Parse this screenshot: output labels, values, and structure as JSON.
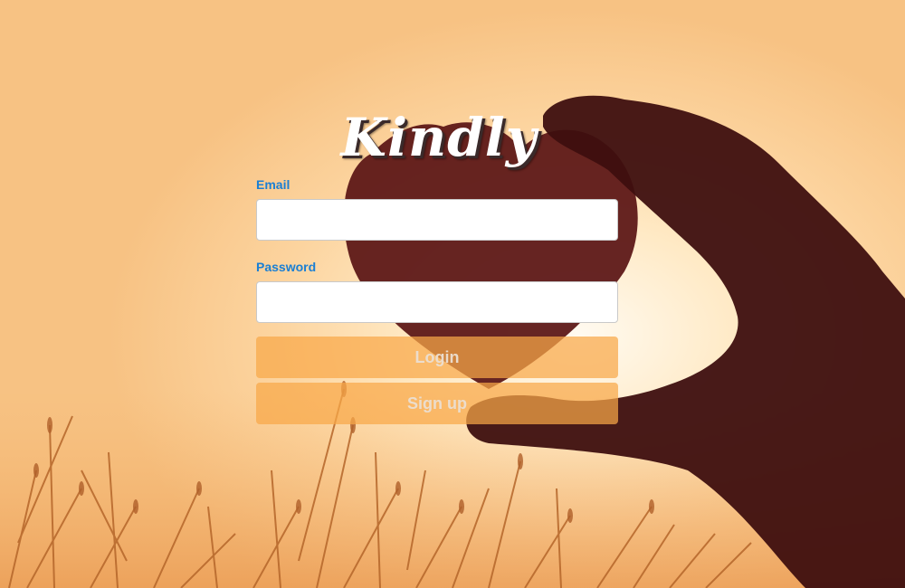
{
  "app": {
    "logo_text": "Kindly"
  },
  "form": {
    "email_label": "Email",
    "email_value": "",
    "password_label": "Password",
    "password_value": "",
    "login_label": "Login",
    "signup_label": "Sign up"
  },
  "colors": {
    "label_blue": "#1a7fd4",
    "button_orange": "#f8a848",
    "logo_white": "#ffffff"
  },
  "icons": {
    "background": "heart-in-hand-sunset-photo"
  }
}
